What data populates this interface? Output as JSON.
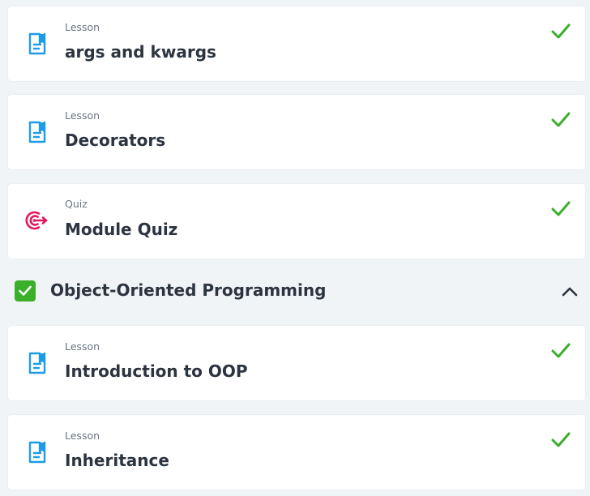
{
  "colors": {
    "page_background": "#f1f4f7",
    "card_background": "#ffffff",
    "lesson_icon": "#1e9be6",
    "quiz_icon": "#e0195f",
    "complete_check": "#3aaf2a",
    "title_text": "#2b3440",
    "type_text": "#6b7684"
  },
  "top_items": [
    {
      "type": "Lesson",
      "title": "args and kwargs",
      "icon": "document-icon",
      "status": "completed"
    },
    {
      "type": "Lesson",
      "title": "Decorators",
      "icon": "document-icon",
      "status": "completed"
    },
    {
      "type": "Quiz",
      "title": "Module Quiz",
      "icon": "target-icon",
      "status": "completed"
    }
  ],
  "section": {
    "title": "Object-Oriented Programming",
    "completed": true,
    "expanded": true,
    "toggle_icon": "chevron-up-icon",
    "items": [
      {
        "type": "Lesson",
        "title": "Introduction to OOP",
        "icon": "document-icon",
        "status": "completed"
      },
      {
        "type": "Lesson",
        "title": "Inheritance",
        "icon": "document-icon",
        "status": "completed"
      }
    ]
  }
}
